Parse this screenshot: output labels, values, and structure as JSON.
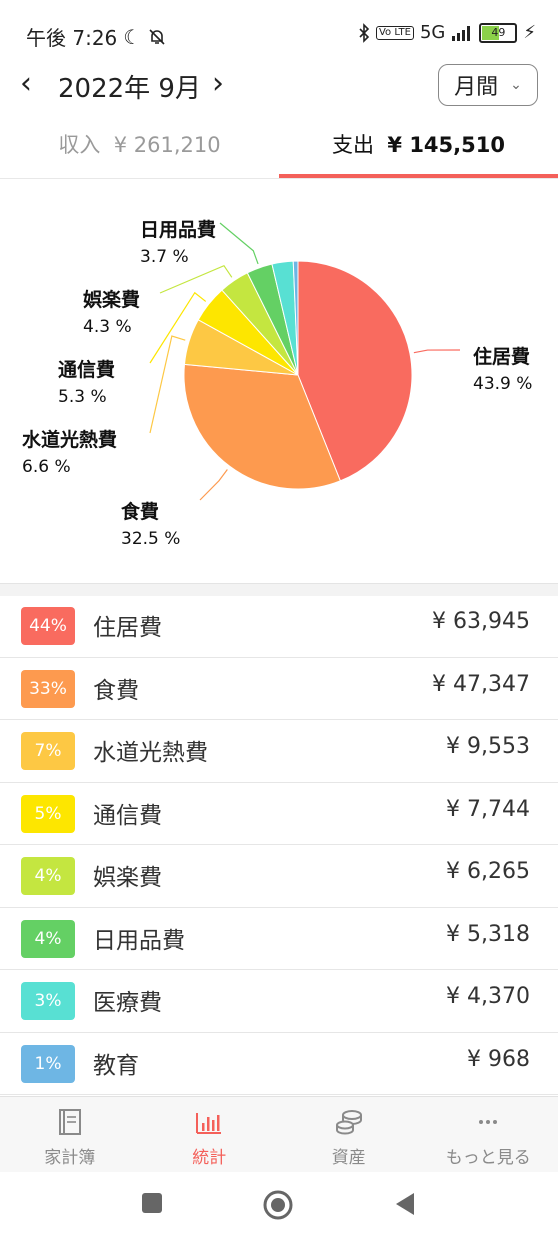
{
  "status_bar": {
    "time": "午後 7:26",
    "network": "5G",
    "volte": "Vo LTE",
    "battery": "49"
  },
  "header": {
    "month": "2022年 9月",
    "period": "月間"
  },
  "tabs": {
    "income_label": "収入",
    "income_amount": "¥ 261,210",
    "expense_label": "支出",
    "expense_amount": "¥ 145,510"
  },
  "chart_data": {
    "type": "pie",
    "slices": [
      {
        "label": "住居費",
        "percent_label": "43.9 %",
        "value": 63945,
        "color": "#f96b5f"
      },
      {
        "label": "食費",
        "percent_label": "32.5 %",
        "value": 47347,
        "color": "#fd9a4f"
      },
      {
        "label": "水道光熱費",
        "percent_label": "6.6 %",
        "value": 9553,
        "color": "#fdc844"
      },
      {
        "label": "通信費",
        "percent_label": "5.3 %",
        "value": 7744,
        "color": "#fde600"
      },
      {
        "label": "娯楽費",
        "percent_label": "4.3 %",
        "value": 6265,
        "color": "#c4e640"
      },
      {
        "label": "日用品費",
        "percent_label": "3.7 %",
        "value": 5318,
        "color": "#64d064"
      },
      {
        "label": "医療費",
        "percent_label": "",
        "value": 4370,
        "color": "#58e0d3"
      },
      {
        "label": "教育",
        "percent_label": "",
        "value": 968,
        "color": "#6eb6e4"
      }
    ]
  },
  "categories": [
    {
      "badge": "44%",
      "name": "住居費",
      "amount": "¥ 63,945",
      "color": "#f96b5f"
    },
    {
      "badge": "33%",
      "name": "食費",
      "amount": "¥ 47,347",
      "color": "#fd9a4f"
    },
    {
      "badge": "7%",
      "name": "水道光熱費",
      "amount": "¥ 9,553",
      "color": "#fdc844"
    },
    {
      "badge": "5%",
      "name": "通信費",
      "amount": "¥ 7,744",
      "color": "#fde600"
    },
    {
      "badge": "4%",
      "name": "娯楽費",
      "amount": "¥ 6,265",
      "color": "#c4e640"
    },
    {
      "badge": "4%",
      "name": "日用品費",
      "amount": "¥ 5,318",
      "color": "#64d064"
    },
    {
      "badge": "3%",
      "name": "医療費",
      "amount": "¥ 4,370",
      "color": "#58e0d3"
    },
    {
      "badge": "1%",
      "name": "教育",
      "amount": "¥ 968",
      "color": "#6eb6e4"
    }
  ],
  "bottom_nav": [
    {
      "label": "家計簿",
      "icon": "book-icon"
    },
    {
      "label": "統計",
      "icon": "bar-chart-icon"
    },
    {
      "label": "資産",
      "icon": "coins-icon"
    },
    {
      "label": "もっと見る",
      "icon": "more-icon"
    }
  ],
  "accent_color": "#f4605a"
}
